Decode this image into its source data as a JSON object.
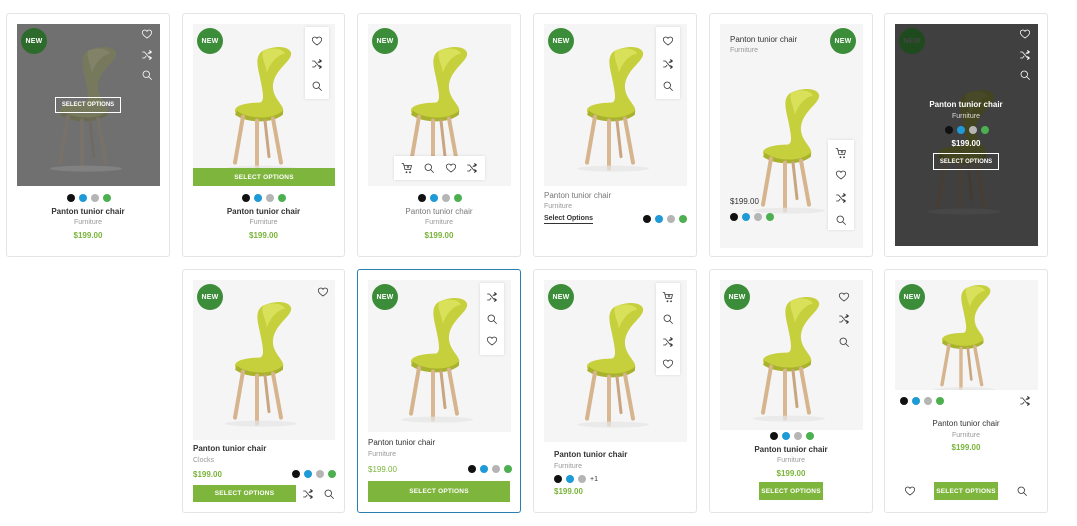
{
  "product": {
    "name": "Panton tunior chair",
    "category": "Furniture",
    "category_alt": "Clocks",
    "price": "$199.00",
    "badge": "NEW",
    "select_options_upper": "SELECT OPTIONS",
    "select_options_title": "Select Options",
    "extra_colors": "+1"
  },
  "colors": {
    "brand_green": "#7eb53c",
    "badge_green": "#3c8d3a",
    "price_green": "#7ab43a",
    "active_border": "#2a7fb0",
    "swatch_black": "#111111",
    "swatch_blue": "#1e9ad6",
    "swatch_gray": "#b5b5b5",
    "swatch_green": "#4caf50"
  },
  "icons": [
    "heart-icon",
    "shuffle-icon",
    "search-icon",
    "cart-icon"
  ]
}
